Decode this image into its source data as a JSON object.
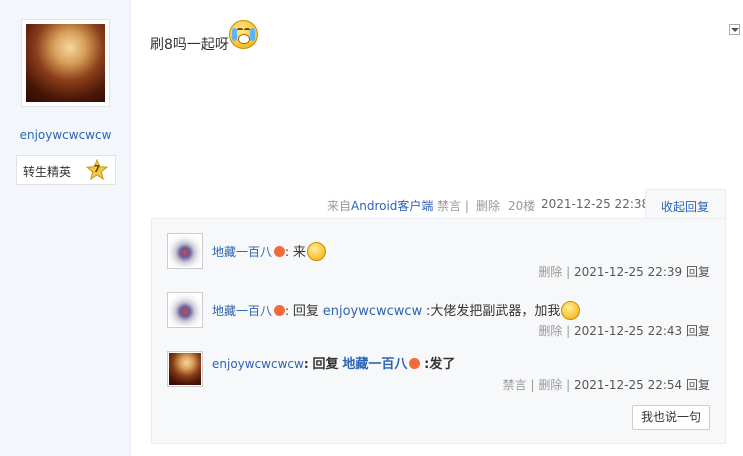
{
  "user": {
    "name": "enjoywcwcwcw",
    "level_title": "转生精英",
    "level_num": "7"
  },
  "post": {
    "text": "刷8吗一起呀",
    "emoji": "crying-face-icon"
  },
  "post_meta": {
    "source_prefix": "来自",
    "source_link": "Android客户端",
    "ban": "禁言 |",
    "delete": "删除",
    "floor": "20楼",
    "time": "2021-12-25 22:38",
    "collapse": "收起回复"
  },
  "replies": [
    {
      "user": "地藏一百八",
      "sep": ":",
      "content": "来",
      "meta_actions": "删除 |",
      "time": "2021-12-25 22:39",
      "reply": "回复"
    },
    {
      "user": "地藏一百八",
      "sep": ":",
      "reply_label": "回复",
      "reply_to": "enjoywcwcwcw",
      "content": ":大佬发把副武器，加我",
      "meta_actions": "删除 |",
      "time": "2021-12-25 22:43",
      "reply": "回复"
    },
    {
      "user": "enjoywcwcwcw",
      "sep": ":",
      "reply_label": "回复",
      "reply_to": "地藏一百八",
      "content": ":发了",
      "meta_actions": "禁言 | 删除 |",
      "time": "2021-12-25 22:54",
      "reply": "回复"
    }
  ],
  "say_button": "我也说一句",
  "colors": {
    "link": "#2d64b3",
    "sidebar_bg": "#f3f7fc",
    "reply_bg": "#f7f8fa"
  }
}
